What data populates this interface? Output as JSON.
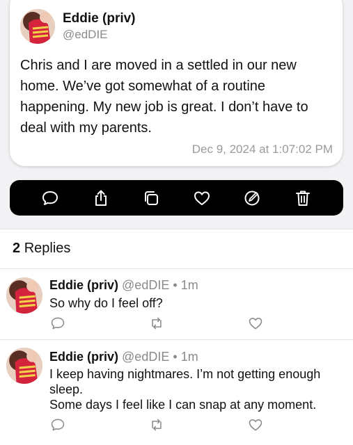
{
  "post": {
    "author_name": "Eddie (priv)",
    "author_handle": "@edDIE",
    "text": "Chris and I are moved in a settled in our new home. We’ve got somewhat of a routine happening. My new job is great. I don’t have to deal with my parents.",
    "timestamp": "Dec 9, 2024 at 1:07:02 PM"
  },
  "action_bar": {
    "icons": [
      "comment-icon",
      "share-icon",
      "copy-icon",
      "heart-icon",
      "edit-icon",
      "trash-icon"
    ]
  },
  "replies": {
    "count": "2",
    "label": "Replies",
    "items": [
      {
        "name": "Eddie (priv)",
        "handle": "@edDIE",
        "separator": "•",
        "time": "1m",
        "text": "So why do I feel off?"
      },
      {
        "name": "Eddie (priv)",
        "handle": "@edDIE",
        "separator": "•",
        "time": "1m",
        "text": "I keep having nightmares. I’m not getting enough sleep.\nSome days I feel like I can snap at any moment."
      }
    ]
  },
  "colors": {
    "background": "#f2f2f5",
    "card": "#ffffff",
    "action_bar": "#000000",
    "secondary_text": "#8a8a8e"
  }
}
